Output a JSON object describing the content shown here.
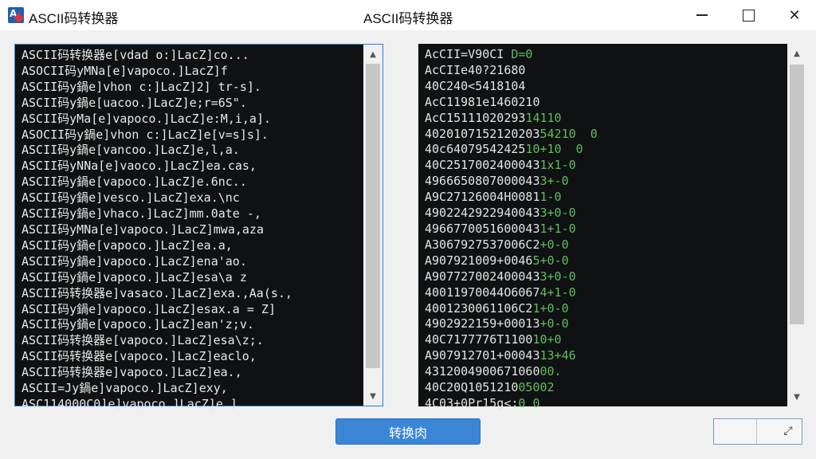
{
  "window": {
    "title": "ASCII码转换器",
    "center_title": "ASCII码转换器",
    "icon": "app-icon",
    "controls": {
      "minimize_icon": "minimize-icon",
      "maximize_icon": "maximize-icon",
      "close_icon": "close-icon",
      "close_glyph": "✕"
    }
  },
  "input": {
    "lines": [
      "ASCII码转换器e[vdad o:]LacZ]co...",
      "ASOCII码yMNa[e]vapoco.]LacZ]f",
      "ASCII码y鍋e]vhon c:]LacZ]2] tr-s].",
      "ASCII码y鍋e[uacoo.]LacZ]e;r=6S\".",
      "ASCII码yMa[e]vapoco.]LacZ]e:M,i,a].",
      "ASOCII码y鍋e]vhon c:]LacZ]e[v=s]s].",
      "ASCII码y鍋e[vancoo.]LacZ]e,l,a.",
      "ASCII码yNNa[e]vaoco.]LacZ]ea.cas,",
      "ASCII码y鍋e[vapoco.]LacZ]e.6nc..",
      "ASCII码y鍋e]vesco.]LacZ]exa.\\nc",
      "ASCII码y鍋e]vhaco.]LacZ]mm.0ate -,",
      "ASCII码yMNa[e]vapoco.]LacZ]mwa,aza",
      "ASCII码y鍋e[vapoco.]LacZ]ea.a,",
      "ASCII码y鍋e]vapoco.]LacZ]ena'ao.",
      "ASCII码y鍋e]vapoco.]LacZ]esa\\a z",
      "ASCII码转换器e]vasaco.]LacZ]exa.,Aa(s.,",
      "ASCII码y鍋e]vapoco.]LacZ]esax.a = Z]",
      "ASCII码y鍋e[vapoco.]LacZ]ean'z;v.",
      "ASCII码转换器e[vapoco.]LacZ]esa\\z;.",
      "ASCII码转换器e[vapoco.]LacZ]eaclo,",
      "ASCII码转换器e]vapoco.]LacZ]ea.,",
      "ASCII=Jy鍋e]vapoco.]LacZ]exy,",
      "ASC114000C0]e]vapoco.]LacZ]e.]"
    ]
  },
  "output": {
    "lines": [
      {
        "hex": "AcCII=V90CI ",
        "tail": "D=0"
      },
      {
        "hex": "AcCIIe40?21680",
        "tail": ""
      },
      {
        "hex": "40C240<5418104",
        "tail": ""
      },
      {
        "hex": "AcC11981e1460210",
        "tail": ""
      },
      {
        "hex": "AcC15111020293",
        "tail": "14110"
      },
      {
        "hex": "4020107152120203",
        "tail": "54210  0"
      },
      {
        "hex": "40c64079542425",
        "tail": "10+10  0"
      },
      {
        "hex": "40C2517002400043",
        "tail": "1x1-0"
      },
      {
        "hex": "4966650807000043",
        "tail": "3+-0"
      },
      {
        "hex": "A9C27126004H0081",
        "tail": "1-0"
      },
      {
        "hex": "4902242922940043",
        "tail": "3+0-0"
      },
      {
        "hex": "4966770051600043",
        "tail": "1+1-0"
      },
      {
        "hex": "A3067927537006C2",
        "tail": "+0-0"
      },
      {
        "hex": "A907921009+0046",
        "tail": "5+0-0"
      },
      {
        "hex": "A907727002400043",
        "tail": "3+0-0"
      },
      {
        "hex": "40011970044O6067",
        "tail": "4+1-0"
      },
      {
        "hex": "4001230061106C2",
        "tail": "1+0-0"
      },
      {
        "hex": "4902922159+00013",
        "tail": "+0-0"
      },
      {
        "hex": "40C7177776T1100",
        "tail": "10+0"
      },
      {
        "hex": "A907912701+00043",
        "tail": "13+46"
      },
      {
        "hex": "4312004900671060",
        "tail": "00."
      },
      {
        "hex": "40C20Q1051210",
        "tail": "05002"
      },
      {
        "hex": "4C03+0Pr15g<;",
        "tail": "0 0"
      }
    ]
  },
  "actions": {
    "convert_label": "转换肉"
  },
  "status": {
    "resize_icon": "resize-grip-icon",
    "resize_glyph": "⤢"
  },
  "colors": {
    "accent": "#3a86d4",
    "output_green": "#5fbf5f",
    "pane_bg": "#0f1112"
  }
}
